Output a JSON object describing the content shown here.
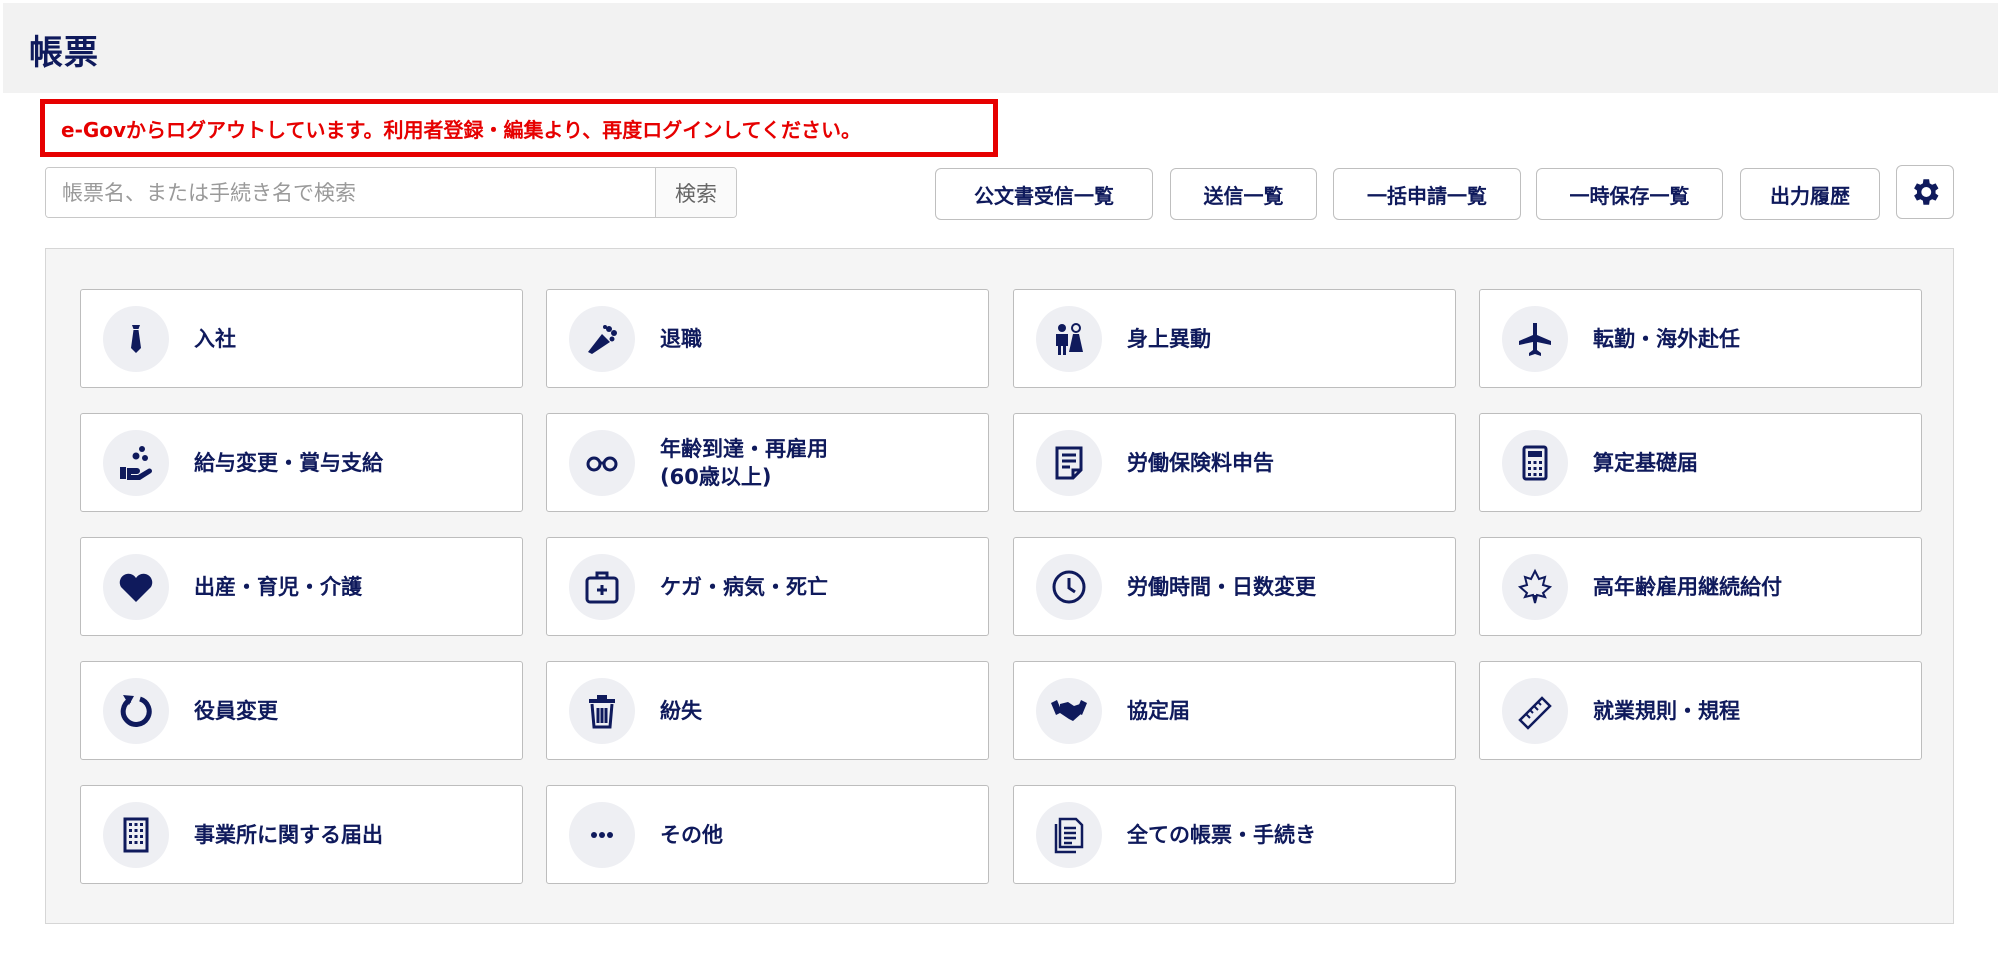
{
  "page": {
    "title": "帳票"
  },
  "alert": {
    "message": "e-Govからログアウトしています。利用者登録・編集より、再度ログインしてください。"
  },
  "search": {
    "placeholder": "帳票名、または手続き名で検索",
    "button": "検索"
  },
  "toolbar": {
    "official_docs": "公文書受信一覧",
    "sent": "送信一覧",
    "batch": "一括申請一覧",
    "temp_saved": "一時保存一覧",
    "output_history": "出力履歴",
    "settings_icon": "gear-icon"
  },
  "categories": [
    {
      "label": "入社",
      "icon": "necktie-icon"
    },
    {
      "label": "退職",
      "icon": "bouquet-icon"
    },
    {
      "label": "身上異動",
      "icon": "wedding-couple-icon"
    },
    {
      "label": "転勤・海外赴任",
      "icon": "airplane-icon"
    },
    {
      "label": "給与変更・賞与支給",
      "icon": "hand-coins-icon"
    },
    {
      "label": "年齢到達・再雇用\n(60歳以上)",
      "icon": "glasses-icon"
    },
    {
      "label": "労働保険料申告",
      "icon": "document-icon"
    },
    {
      "label": "算定基礎届",
      "icon": "calculator-icon"
    },
    {
      "label": "出産・育児・介護",
      "icon": "heart-icon"
    },
    {
      "label": "ケガ・病気・死亡",
      "icon": "first-aid-kit-icon"
    },
    {
      "label": "労働時間・日数変更",
      "icon": "clock-icon"
    },
    {
      "label": "高年齢雇用継続給付",
      "icon": "maple-leaf-icon"
    },
    {
      "label": "役員変更",
      "icon": "refresh-icon"
    },
    {
      "label": "紛失",
      "icon": "trash-icon"
    },
    {
      "label": "協定届",
      "icon": "handshake-icon"
    },
    {
      "label": "就業規則・規程",
      "icon": "ruler-icon"
    },
    {
      "label": "事業所に関する届出",
      "icon": "building-icon"
    },
    {
      "label": "その他",
      "icon": "more-icon"
    },
    {
      "label": "全ての帳票・手続き",
      "icon": "documents-icon"
    }
  ]
}
